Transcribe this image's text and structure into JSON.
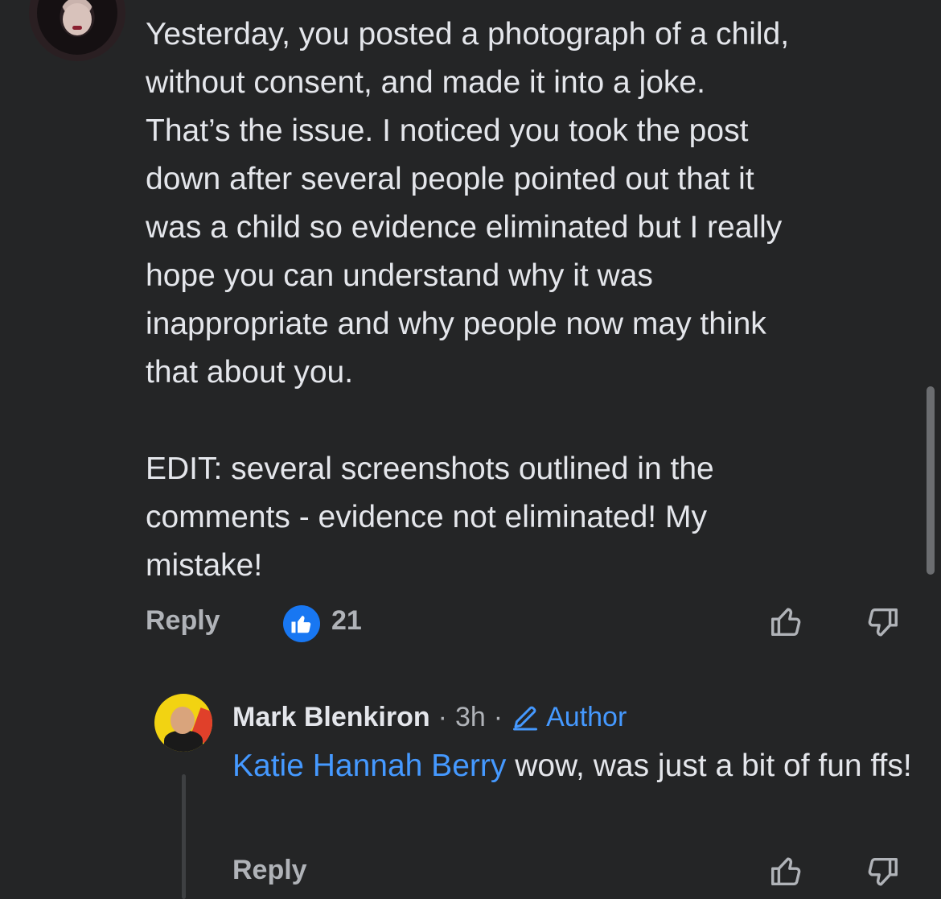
{
  "comment": {
    "body": "Yesterday, you posted a photograph of a child,\nwithout consent, and made it into a joke.\nThat’s the issue. I noticed you took the post\ndown after several people pointed out that it\nwas a child so evidence eliminated but I really\nhope you can understand why it was\ninappropriate and why people now may think\nthat about you.\n\nEDIT: several screenshots outlined in the\ncomments - evidence not eliminated! My\nmistake!",
    "reply_label": "Reply",
    "like_count": "21",
    "avatar_icon": "profile-photo",
    "like_icon": "thumbs-up-icon",
    "upvote_icon": "upvote-icon",
    "downvote_icon": "downvote-icon"
  },
  "reply": {
    "author": "Mark Blenkiron",
    "time": "3h",
    "badge_label": "Author",
    "badge_icon": "pencil-icon",
    "mention": "Katie Hannah Berry",
    "text": " wow, was just a bit of fun ffs!",
    "reply_label": "Reply",
    "avatar_icon": "profile-photo"
  },
  "colors": {
    "background": "#242526",
    "text": "#e4e6eb",
    "muted": "#b0b3b8",
    "accent": "#4599ff",
    "like": "#1877f2"
  }
}
